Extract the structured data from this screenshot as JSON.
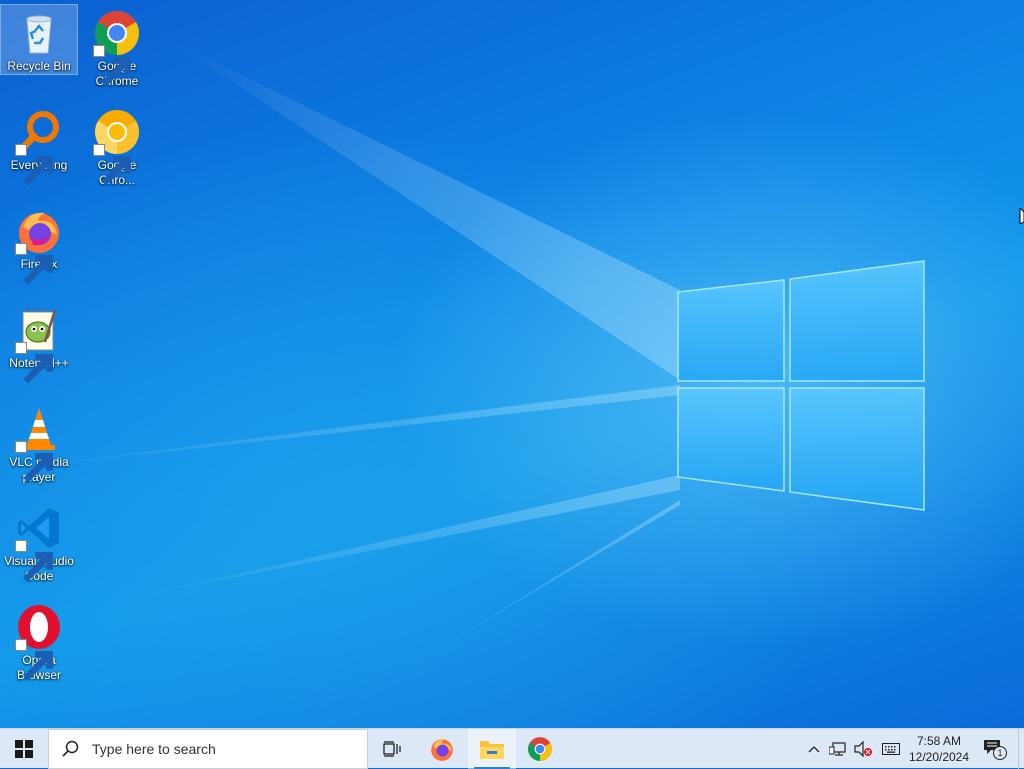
{
  "desktop": {
    "icons": [
      {
        "label": "Recycle Bin",
        "icon": "recycle-bin-icon",
        "shortcut": false,
        "selected": true
      },
      {
        "label": "Google Chrome",
        "icon": "chrome-icon",
        "shortcut": true
      },
      {
        "label": "Everything",
        "icon": "everything-search-icon",
        "shortcut": true
      },
      {
        "label": "Google Chro...",
        "icon": "chrome-canary-icon",
        "shortcut": true
      },
      {
        "label": "Firefox",
        "icon": "firefox-icon",
        "shortcut": true
      },
      {
        "label": "Notepad++",
        "icon": "notepad-plus-plus-icon",
        "shortcut": true
      },
      {
        "label": "VLC media player",
        "icon": "vlc-icon",
        "shortcut": true
      },
      {
        "label": "Visual Studio Code",
        "icon": "vscode-icon",
        "shortcut": true
      },
      {
        "label": "Opera Browser",
        "icon": "opera-icon",
        "shortcut": true
      }
    ]
  },
  "taskbar": {
    "search_placeholder": "Type here to search",
    "pinned": [
      {
        "name": "task-view-icon"
      },
      {
        "name": "firefox-icon"
      },
      {
        "name": "file-explorer-icon",
        "active": true
      },
      {
        "name": "chrome-icon"
      }
    ],
    "tray": {
      "time": "7:58 AM",
      "date": "12/20/2024",
      "notification_count": "1"
    }
  },
  "colors": {
    "wallpaper": "#0a6fd6",
    "taskbar": "#dce8f5",
    "accent": "#2a7fd4"
  }
}
